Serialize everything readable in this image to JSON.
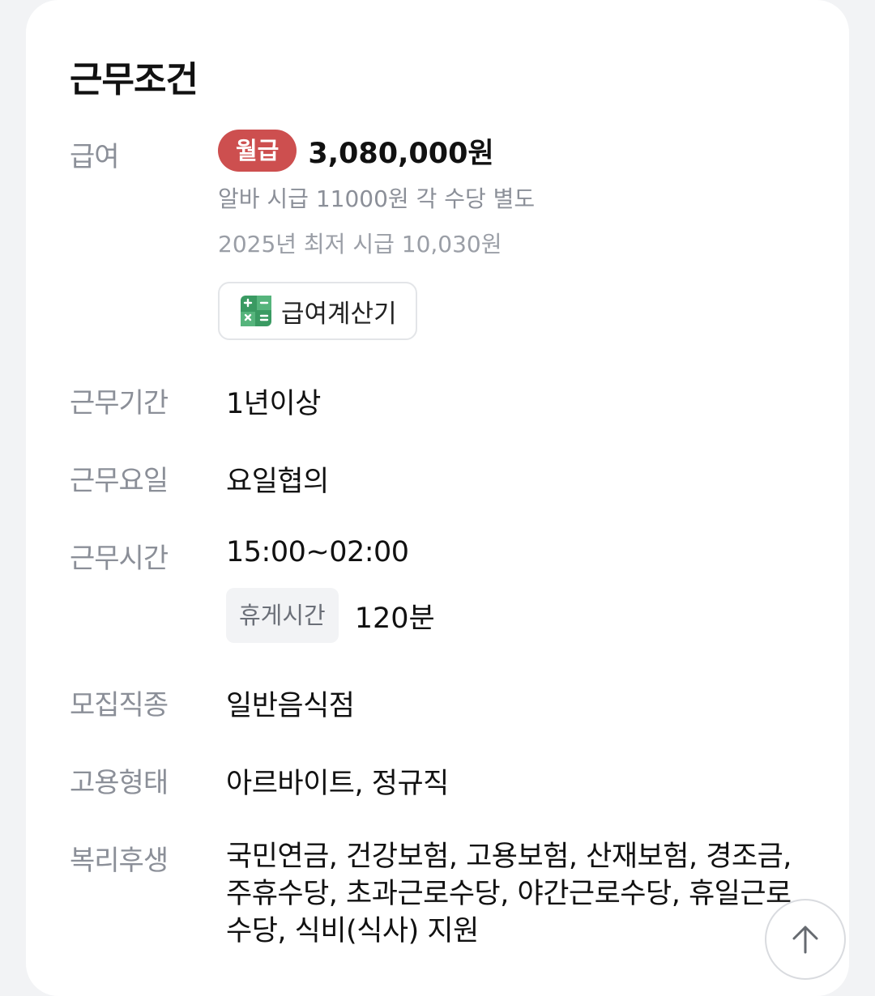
{
  "section": {
    "title": "근무조건"
  },
  "salary": {
    "label": "급여",
    "pay_type": "월급",
    "amount": "3,080,000원",
    "note": "알바 시급 11000원 각 수당 별도",
    "minimum_wage": "2025년 최저 시급 10,030원",
    "calculator_label": "급여계산기",
    "calculator_icon": "calculator-icon",
    "badge_color": "#cd4f4f",
    "calculator_color": "#3a9a62"
  },
  "period": {
    "label": "근무기간",
    "value": "1년이상"
  },
  "days": {
    "label": "근무요일",
    "value": "요일협의"
  },
  "hours": {
    "label": "근무시간",
    "value": "15:00~02:00",
    "break_label": "휴게시간",
    "break_value": "120분"
  },
  "job_type": {
    "label": "모집직종",
    "value": "일반음식점"
  },
  "employment": {
    "label": "고용형태",
    "value": "아르바이트, 정규직"
  },
  "welfare": {
    "label": "복리후생",
    "value": "국민연금, 건강보험, 고용보험, 산재보험, 경조금, 주휴수당, 초과근로수당, 야간근로수당, 휴일근로수당, 식비(식사) 지원"
  },
  "scroll_top": {
    "icon": "arrow-up-icon"
  }
}
